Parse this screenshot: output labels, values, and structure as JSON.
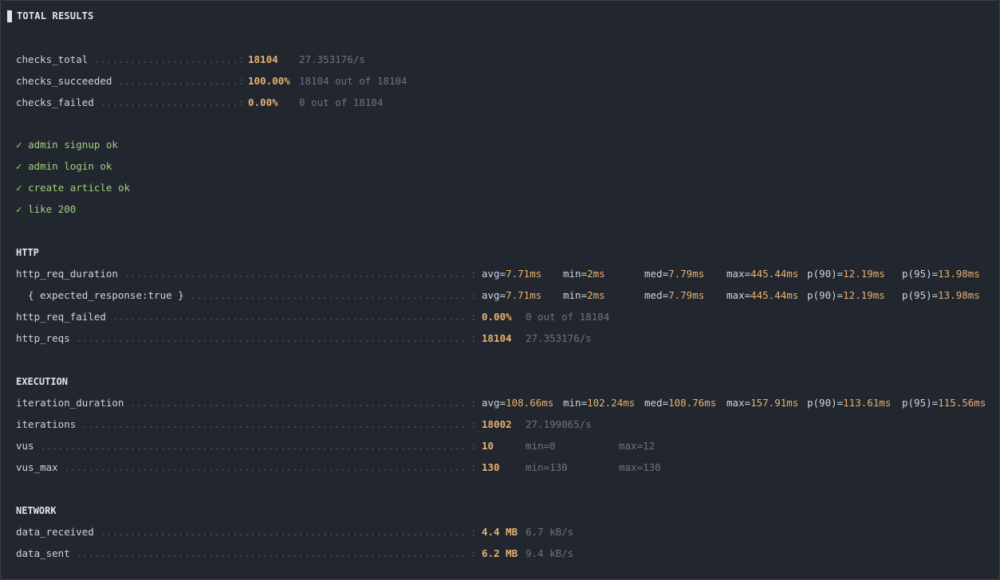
{
  "header": {
    "title": "TOTAL RESULTS"
  },
  "checks_summary": [
    {
      "name": "checks_total",
      "value": "18104",
      "extra": "27.353176/s"
    },
    {
      "name": "checks_succeeded",
      "value": "100.00%",
      "extra": "18104 out of 18104"
    },
    {
      "name": "checks_failed",
      "value": "0.00%",
      "extra": "0 out of 18104"
    }
  ],
  "checks": [
    {
      "mark": "✓",
      "label": "admin signup ok"
    },
    {
      "mark": "✓",
      "label": "admin login ok"
    },
    {
      "mark": "✓",
      "label": "create article ok"
    },
    {
      "mark": "✓",
      "label": "like 200"
    }
  ],
  "http": {
    "title": "HTTP",
    "rows": [
      {
        "name": "http_req_duration",
        "stats": [
          {
            "k": "avg=",
            "v": "7.71ms"
          },
          {
            "k": "min=",
            "v": "2ms"
          },
          {
            "k": "med=",
            "v": "7.79ms"
          },
          {
            "k": "max=",
            "v": "445.44ms"
          },
          {
            "k": "p(90)=",
            "v": "12.19ms"
          },
          {
            "k": "p(95)=",
            "v": "13.98ms"
          }
        ]
      },
      {
        "name": "{ expected_response:true }",
        "stats": [
          {
            "k": "avg=",
            "v": "7.71ms"
          },
          {
            "k": "min=",
            "v": "2ms"
          },
          {
            "k": "med=",
            "v": "7.79ms"
          },
          {
            "k": "max=",
            "v": "445.44ms"
          },
          {
            "k": "p(90)=",
            "v": "12.19ms"
          },
          {
            "k": "p(95)=",
            "v": "13.98ms"
          }
        ]
      },
      {
        "name": "http_req_failed",
        "value": "0.00%",
        "extra": "0 out of 18104"
      },
      {
        "name": "http_reqs",
        "value": "18104",
        "extra": "27.353176/s"
      }
    ]
  },
  "execution": {
    "title": "EXECUTION",
    "rows": [
      {
        "name": "iteration_duration",
        "stats": [
          {
            "k": "avg=",
            "v": "108.66ms"
          },
          {
            "k": "min=",
            "v": "102.24ms"
          },
          {
            "k": "med=",
            "v": "108.76ms"
          },
          {
            "k": "max=",
            "v": "157.91ms"
          },
          {
            "k": "p(90)=",
            "v": "113.61ms"
          },
          {
            "k": "p(95)=",
            "v": "115.56ms"
          }
        ]
      },
      {
        "name": "iterations",
        "value": "18002",
        "extra": "27.199065/s"
      },
      {
        "name": "vus",
        "value": "10",
        "min": "min=0",
        "max": "max=12"
      },
      {
        "name": "vus_max",
        "value": "130",
        "min": "min=130",
        "max": "max=130"
      }
    ]
  },
  "network": {
    "title": "NETWORK",
    "rows": [
      {
        "name": "data_received",
        "value": "4.4 MB",
        "extra": "6.7 kB/s"
      },
      {
        "name": "data_sent",
        "value": "6.2 MB",
        "extra": "9.4 kB/s"
      }
    ]
  }
}
